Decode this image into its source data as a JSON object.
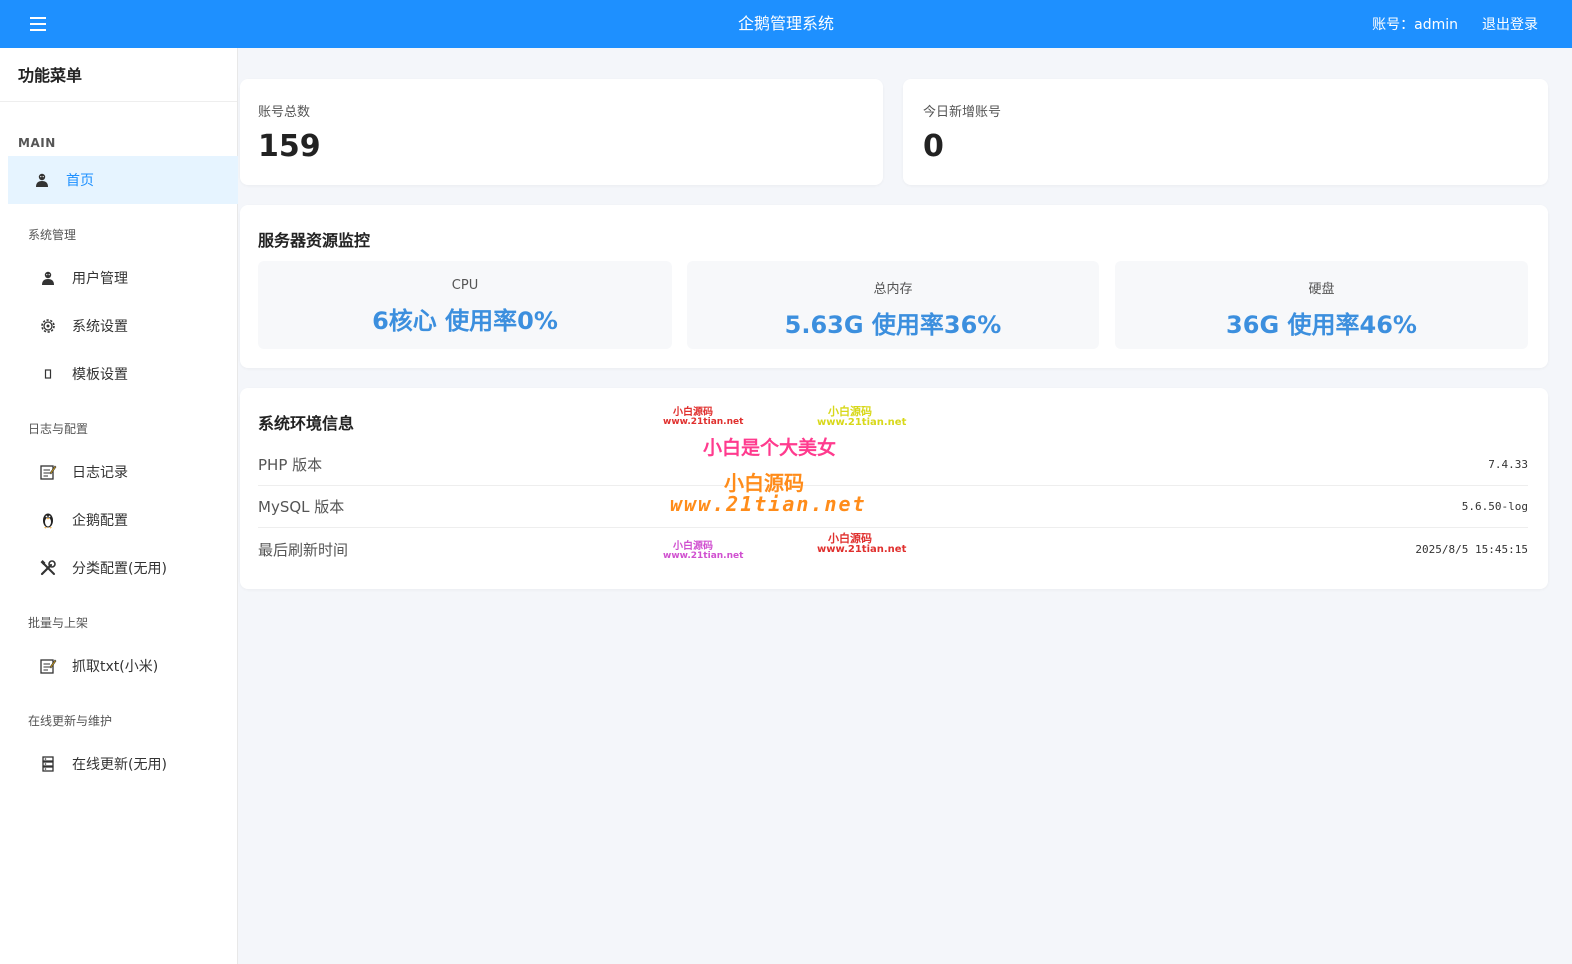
{
  "header": {
    "title": "企鹅管理系统",
    "account_label": "账号：admin",
    "logout_label": "退出登录",
    "accent_color": "#1e90ff"
  },
  "sidebar": {
    "title": "功能菜单",
    "main_label": "MAIN",
    "home": {
      "label": "首页",
      "icon": "user-icon"
    },
    "groups": [
      {
        "title": "系统管理",
        "items": [
          {
            "label": "用户管理",
            "icon": "user-icon"
          },
          {
            "label": "系统设置",
            "icon": "gear-icon"
          },
          {
            "label": "模板设置",
            "icon": "template-icon"
          }
        ]
      },
      {
        "title": "日志与配置",
        "items": [
          {
            "label": "日志记录",
            "icon": "notepad-icon"
          },
          {
            "label": "企鹅配置",
            "icon": "penguin-icon"
          },
          {
            "label": "分类配置(无用)",
            "icon": "tools-icon"
          }
        ]
      },
      {
        "title": "批量与上架",
        "items": [
          {
            "label": "抓取txt(小米)",
            "icon": "notepad-icon"
          }
        ]
      },
      {
        "title": "在线更新与维护",
        "items": [
          {
            "label": "在线更新(无用)",
            "icon": "server-icon"
          }
        ]
      }
    ]
  },
  "stats": {
    "total_accounts_label": "账号总数",
    "total_accounts_value": "159",
    "new_today_label": "今日新增账号",
    "new_today_value": "0"
  },
  "monitor": {
    "title": "服务器资源监控",
    "cpu_label": "CPU",
    "cpu_value": "6核心 使用率0%",
    "memory_label": "总内存",
    "memory_value": "5.63G 使用率36%",
    "disk_label": "硬盘",
    "disk_value": "36G 使用率46%",
    "value_color": "#3c8fde"
  },
  "env": {
    "title": "系统环境信息",
    "rows": [
      {
        "key": "PHP 版本",
        "value": "7.4.33"
      },
      {
        "key": "MySQL 版本",
        "value": "5.6.50-log"
      },
      {
        "key": "最后刷新时间",
        "value": "2025/8/5 15:45:15"
      }
    ]
  },
  "watermark": {
    "small_cn": "小白源码",
    "small_url": "www.21tian.net",
    "slogan": "小白是个大美女",
    "big_cn": "小白源码",
    "big_url": "www.21tian.net"
  }
}
